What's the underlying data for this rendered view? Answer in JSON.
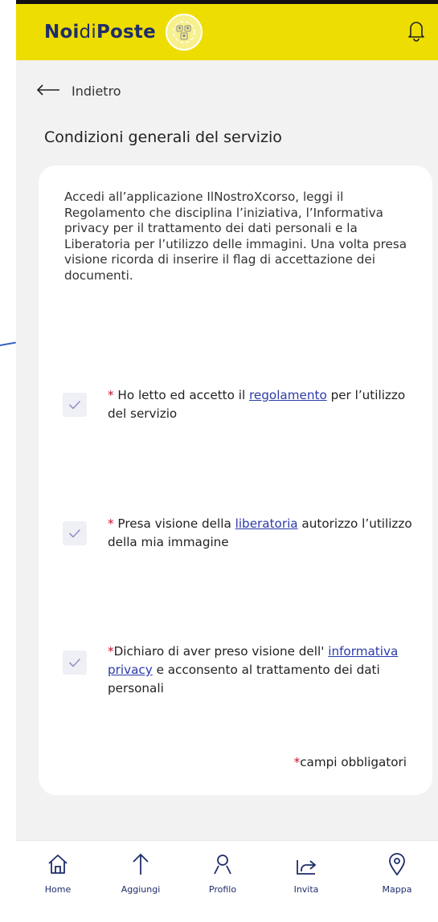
{
  "header": {
    "logo_part1": "Noi",
    "logo_part2": "di",
    "logo_part3": "Poste",
    "brand_color": "#eedd00",
    "logo_color": "#1f2d6b",
    "notification_icon": "bell-icon"
  },
  "nav": {
    "back_label": "Indietro",
    "back_icon": "arrow-left-icon"
  },
  "page": {
    "title": "Condizioni generali del servizio",
    "intro": "Accedi all’applicazione IlNostroXcorso, leggi il Regolamento che disciplina l’iniziativa, l’Informativa privacy per il trattamento dei dati personali e la Liberatoria per l’utilizzo delle immagini. Una volta presa visione ricorda di inserire il flag di accettazione dei documenti."
  },
  "consents": [
    {
      "checked": true,
      "asterisk": "*",
      "before": " Ho letto ed accetto il ",
      "link": "regolamento",
      "after": " per l’utilizzo del servizio"
    },
    {
      "checked": true,
      "asterisk": "*",
      "before": " Presa visione della ",
      "link": "liberatoria",
      "after": " autorizzo l’utilizzo della mia immagine"
    },
    {
      "checked": true,
      "asterisk": "*",
      "before": "Dichiaro di aver preso visione dell' ",
      "link": "informativa privacy",
      "after": " e acconsento al trattamento dei dati personali"
    }
  ],
  "required_note": {
    "asterisk": "*",
    "text": "campi obbligatori"
  },
  "tabbar": [
    {
      "label": "Home",
      "icon": "home-icon"
    },
    {
      "label": "Aggiungi",
      "icon": "arrow-up-icon"
    },
    {
      "label": "Profilo",
      "icon": "person-icon"
    },
    {
      "label": "Invita",
      "icon": "share-icon"
    },
    {
      "label": "Mappa",
      "icon": "map-pin-icon"
    }
  ],
  "colors": {
    "required": "#c8102e",
    "link": "#2a3aa8",
    "check": "#9a90c8",
    "checkbox_bg": "#eef0f6"
  }
}
